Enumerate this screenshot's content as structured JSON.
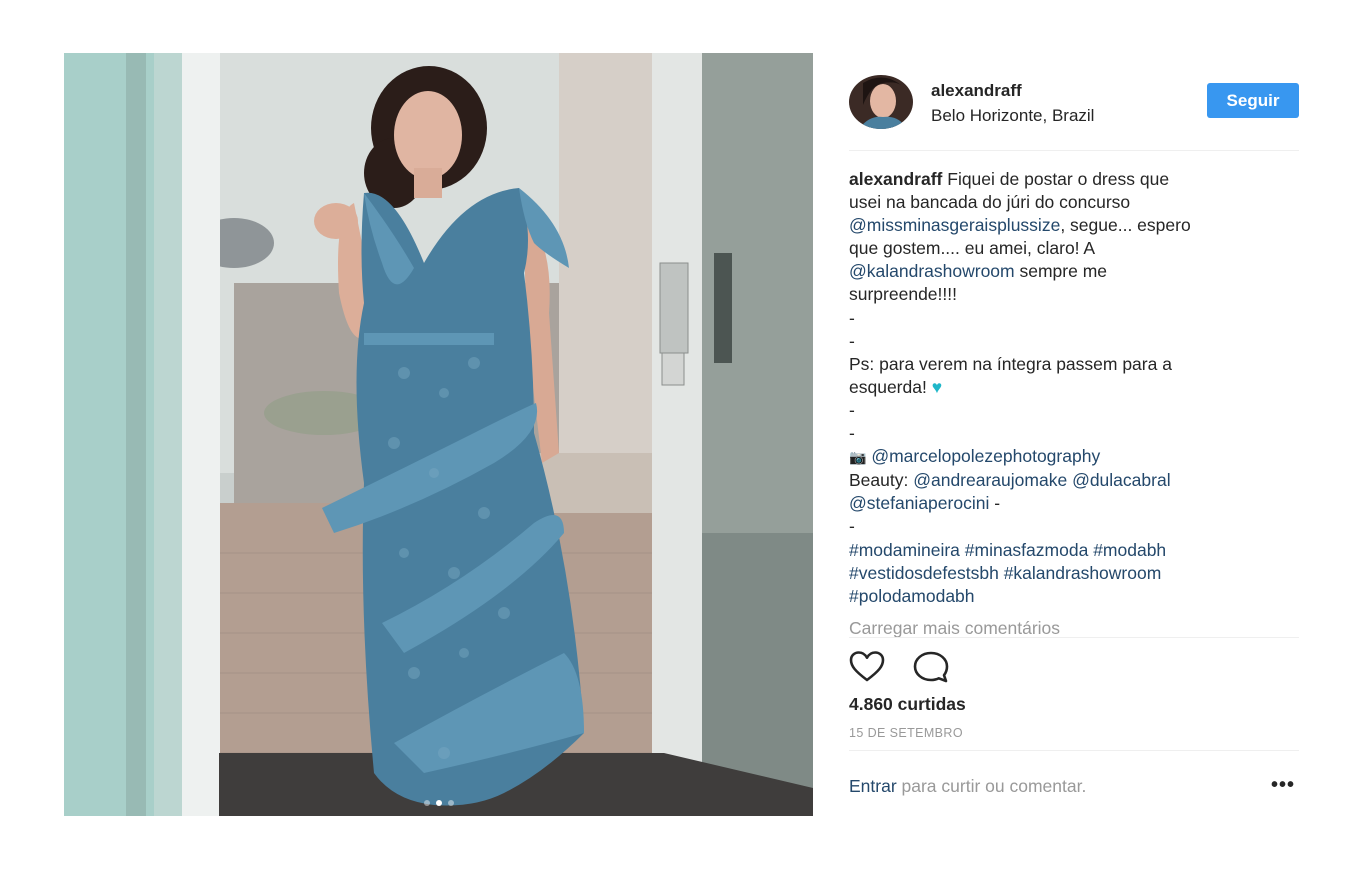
{
  "post": {
    "username": "alexandraff",
    "location": "Belo Horizonte, Brazil",
    "follow_label": "Seguir",
    "caption": {
      "line1": "Fiquei de postar o dress que",
      "line2": "usei na bancada do júri do concurso",
      "mention1": "@missminasgeraisplussize",
      "line3_rest": ", segue... espero",
      "line4": "que gostem.... eu amei, claro! A",
      "mention2": "@kalandrashowroom",
      "line5_rest": " sempre me",
      "line6": "surpreende!!!!",
      "dash": "-",
      "line9": "Ps: para verem na íntegra passem para a",
      "line10": "esquerda! ",
      "heart_emoji": "♥",
      "camera_emoji": "📷",
      "mention3": "@marcelopolezephotography",
      "beauty_label": "Beauty: ",
      "mention4": "@andrearaujomake",
      "space": " ",
      "mention5": "@dulacabral",
      "mention6": "@stefaniaperocini",
      "dash_trail": " -",
      "hashtag1": "#modamineira",
      "hashtag2": "#minasfazmoda",
      "hashtag3": "#modabh",
      "hashtag4": "#vestidosdefestsbh",
      "hashtag5": "#kalandrashowroom",
      "hashtag6": "#polodamodabh"
    },
    "load_more": "Carregar mais comentários",
    "likes": "4.860 curtidas",
    "date": "15 DE SETEMBRO",
    "login_link": "Entrar",
    "login_text": " para curtir ou comentar.",
    "more_label": "•••",
    "carousel": {
      "count": 3,
      "active_index": 1
    },
    "icons": {
      "like": "heart-outline-icon",
      "comment": "speech-bubble-icon",
      "more": "ellipsis-icon"
    },
    "colors": {
      "accent": "#3897f0",
      "link": "#24486b",
      "muted": "#999999",
      "dress": "#4a7f9e"
    }
  }
}
